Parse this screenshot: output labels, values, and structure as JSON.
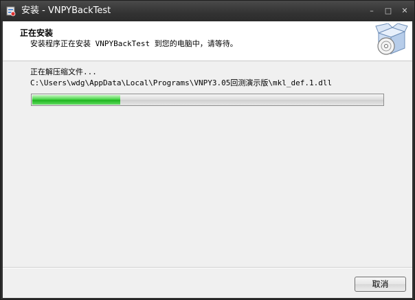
{
  "window": {
    "title": "安装 - VNPYBackTest",
    "controls": {
      "minimize": "–",
      "maximize": "□",
      "close": "✕"
    }
  },
  "header": {
    "title": "正在安装",
    "subtitle": "安装程序正在安装 VNPYBackTest 到您的电脑中，请等待。",
    "icon": "package-disc-icon"
  },
  "main": {
    "status_text": "正在解压缩文件...",
    "current_file": "C:\\Users\\wdg\\AppData\\Local\\Programs\\VNPY3.05回测演示版\\mkl_def.1.dll",
    "progress": 0.25
  },
  "footer": {
    "cancel_label": "取消"
  },
  "colors": {
    "titlebar": "#333333",
    "progress_fill": "#2ec42e",
    "client_bg": "#f0f0f0"
  }
}
